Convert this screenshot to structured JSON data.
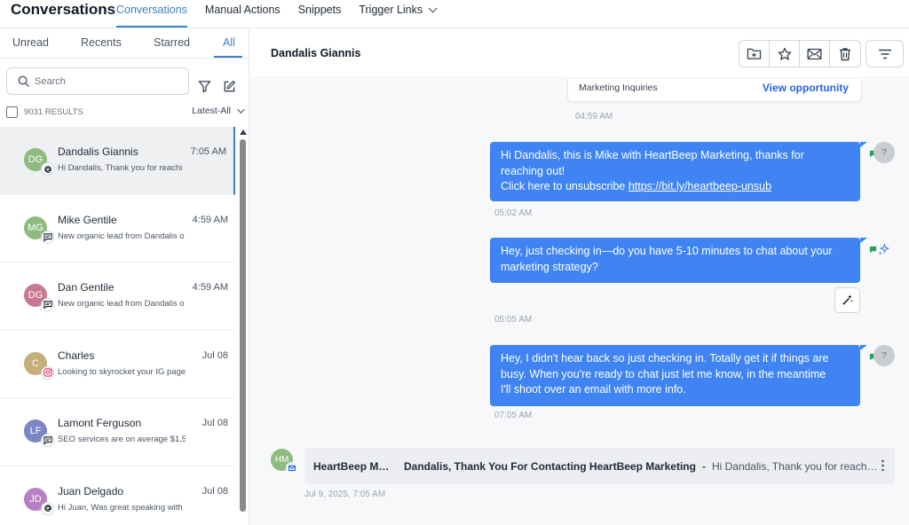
{
  "app": {
    "title": "Conversations"
  },
  "nav": {
    "tabs": [
      {
        "label": "Conversations",
        "active": true
      },
      {
        "label": "Manual Actions"
      },
      {
        "label": "Snippets"
      },
      {
        "label": "Trigger Links"
      }
    ]
  },
  "filters": {
    "tabs": [
      "Unread",
      "Recents",
      "Starred",
      "All"
    ],
    "active": "All"
  },
  "search": {
    "placeholder": "Search",
    "value": ""
  },
  "results": {
    "count_label": "9031 RESULTS",
    "sort_label": "Latest-All"
  },
  "conversations": [
    {
      "initials": "DG",
      "name": "Dandalis Giannis",
      "time": "7:05 AM",
      "preview": "Hi Dandalis, Thank you for reachi",
      "avatar_color": "#8fbc7e",
      "channel_icon": "email-at-icon",
      "selected": true
    },
    {
      "initials": "MG",
      "name": "Mike Gentile",
      "time": "4:59 AM",
      "preview": "New organic lead from Dandalis o",
      "avatar_color": "#8fbc7e",
      "channel_icon": "sms-icon"
    },
    {
      "initials": "DG",
      "name": "Dan Gentile",
      "time": "4:59 AM",
      "preview": "New organic lead from Dandalis o",
      "avatar_color": "#c9788f",
      "channel_icon": "sms-icon"
    },
    {
      "initials": "C",
      "name": "Charles",
      "time": "Jul 08",
      "preview": "Looking to skyrocket your IG page",
      "avatar_color": "#c4ae79",
      "channel_icon": "instagram-icon"
    },
    {
      "initials": "LF",
      "name": "Lamont Ferguson",
      "time": "Jul 08",
      "preview": "SEO services are on average $1,5",
      "avatar_color": "#7b86c4",
      "channel_icon": "sms-icon"
    },
    {
      "initials": "JD",
      "name": "Juan Delgado",
      "time": "Jul 08",
      "preview": "Hi Juan, Was great speaking with",
      "avatar_color": "#b77fc4",
      "channel_icon": "email-at-icon"
    }
  ],
  "chat": {
    "contact_name": "Dandalis Giannis",
    "opportunity": {
      "label": "Marketing Inquiries",
      "link": "View opportunity",
      "time": "04:59 AM"
    },
    "messages": [
      {
        "line1": "Hi Dandalis, this is Mike with HeartBeep Marketing, thanks for",
        "line2": "reaching out!",
        "line3_prefix": "Click here to unsubscribe ",
        "link": "https://bit.ly/heartbeep-unsub",
        "time": "05:02 AM",
        "avatar": "?"
      },
      {
        "line1": "Hey, just checking in—do you have 5-10 minutes to chat about your",
        "line2": "marketing strategy?",
        "time": "05:05 AM"
      },
      {
        "line1": "Hey, I didn't hear back so just checking in. Totally get it if things are",
        "line2": "busy. When you're ready to chat just let me know, in the meantime",
        "line3": "I'll shoot over an email with more info.",
        "time": "07:05 AM",
        "avatar": "?"
      }
    ],
    "email": {
      "avatar": "HM",
      "from": "HeartBeep Marketing",
      "subject": "Dandalis, Thank You For Contacting HeartBeep Marketing",
      "separator": "-",
      "snippet": "Hi Dandalis, Thank you for reaching out",
      "time": "Jul 9, 2025, 7:05 AM"
    }
  },
  "colors": {
    "accent": "#3b82c4",
    "bubble": "#3f84f2",
    "sms_green": "#22a35a"
  }
}
